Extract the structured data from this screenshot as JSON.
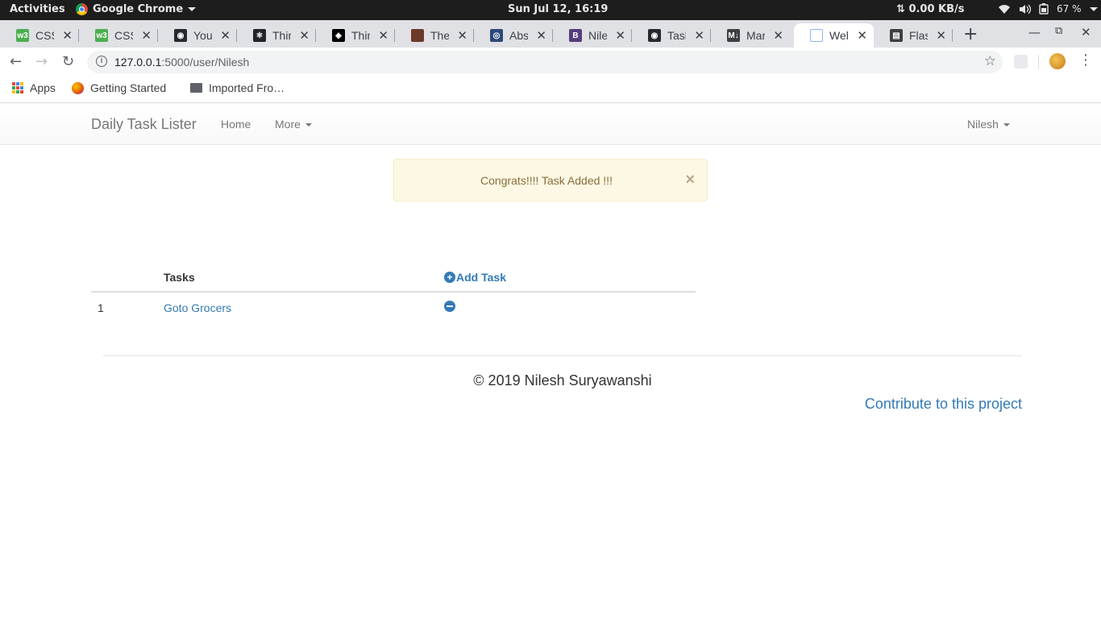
{
  "system_bar": {
    "activities": "Activities",
    "app_name": "Google Chrome",
    "clock": "Sun Jul 12, 16:19",
    "network_speed": "0.00 KB/s",
    "network_arrows": "⇅",
    "battery": "67 %"
  },
  "tabs": [
    {
      "title": "CSS F",
      "icon": "w3schools-icon",
      "color": "#4caf50",
      "glyph": "w3"
    },
    {
      "title": "CSS (",
      "icon": "w3schools-icon",
      "color": "#4caf50",
      "glyph": "w3"
    },
    {
      "title": "Your",
      "icon": "github-icon",
      "color": "#24292e",
      "glyph": "◉"
    },
    {
      "title": "Think",
      "icon": "react-icon",
      "color": "#20232a",
      "glyph": "⚛"
    },
    {
      "title": "Think",
      "icon": "codepen-icon",
      "color": "#000000",
      "glyph": "◈"
    },
    {
      "title": "The F",
      "icon": "portrait-icon",
      "color": "#6d3a2a",
      "glyph": ""
    },
    {
      "title": "Abso",
      "icon": "compass-icon",
      "color": "#2d4a7a",
      "glyph": "◎"
    },
    {
      "title": "Niles",
      "icon": "bootstrap-icon",
      "color": "#563d7c",
      "glyph": "B"
    },
    {
      "title": "Task",
      "icon": "github-icon",
      "color": "#24292e",
      "glyph": "◉"
    },
    {
      "title": "Mark",
      "icon": "markdown-icon",
      "color": "#3c4043",
      "glyph": "M↓"
    },
    {
      "title": "Welc",
      "icon": "page-icon",
      "color": "#8ab4f8",
      "glyph": "",
      "active": true
    },
    {
      "title": "Flask",
      "icon": "doc-icon",
      "color": "#3c4043",
      "glyph": "▤"
    }
  ],
  "omnibox": {
    "host": "127.0.0.1",
    "path": ":5000/user/Nilesh"
  },
  "bookmarks": {
    "apps": "Apps",
    "getting_started": "Getting Started",
    "imported": "Imported Fro…"
  },
  "app": {
    "brand": "Daily Task Lister",
    "nav_home": "Home",
    "nav_more": "More",
    "user": "Nilesh",
    "alert_message": "Congrats!!!! Task Added !!!",
    "alert_close": "×",
    "table_header_tasks": "Tasks",
    "add_task_label": "Add Task",
    "add_task_glyph": "+",
    "tasks": [
      {
        "num": "1",
        "name": "Goto Grocers"
      }
    ],
    "copyright": "© 2019 Nilesh Suryawanshi",
    "contribute": "Contribute to this project"
  },
  "colors": {
    "link": "#337ab7",
    "alert_bg": "#fcf8e3",
    "alert_text": "#8a6d3b"
  }
}
